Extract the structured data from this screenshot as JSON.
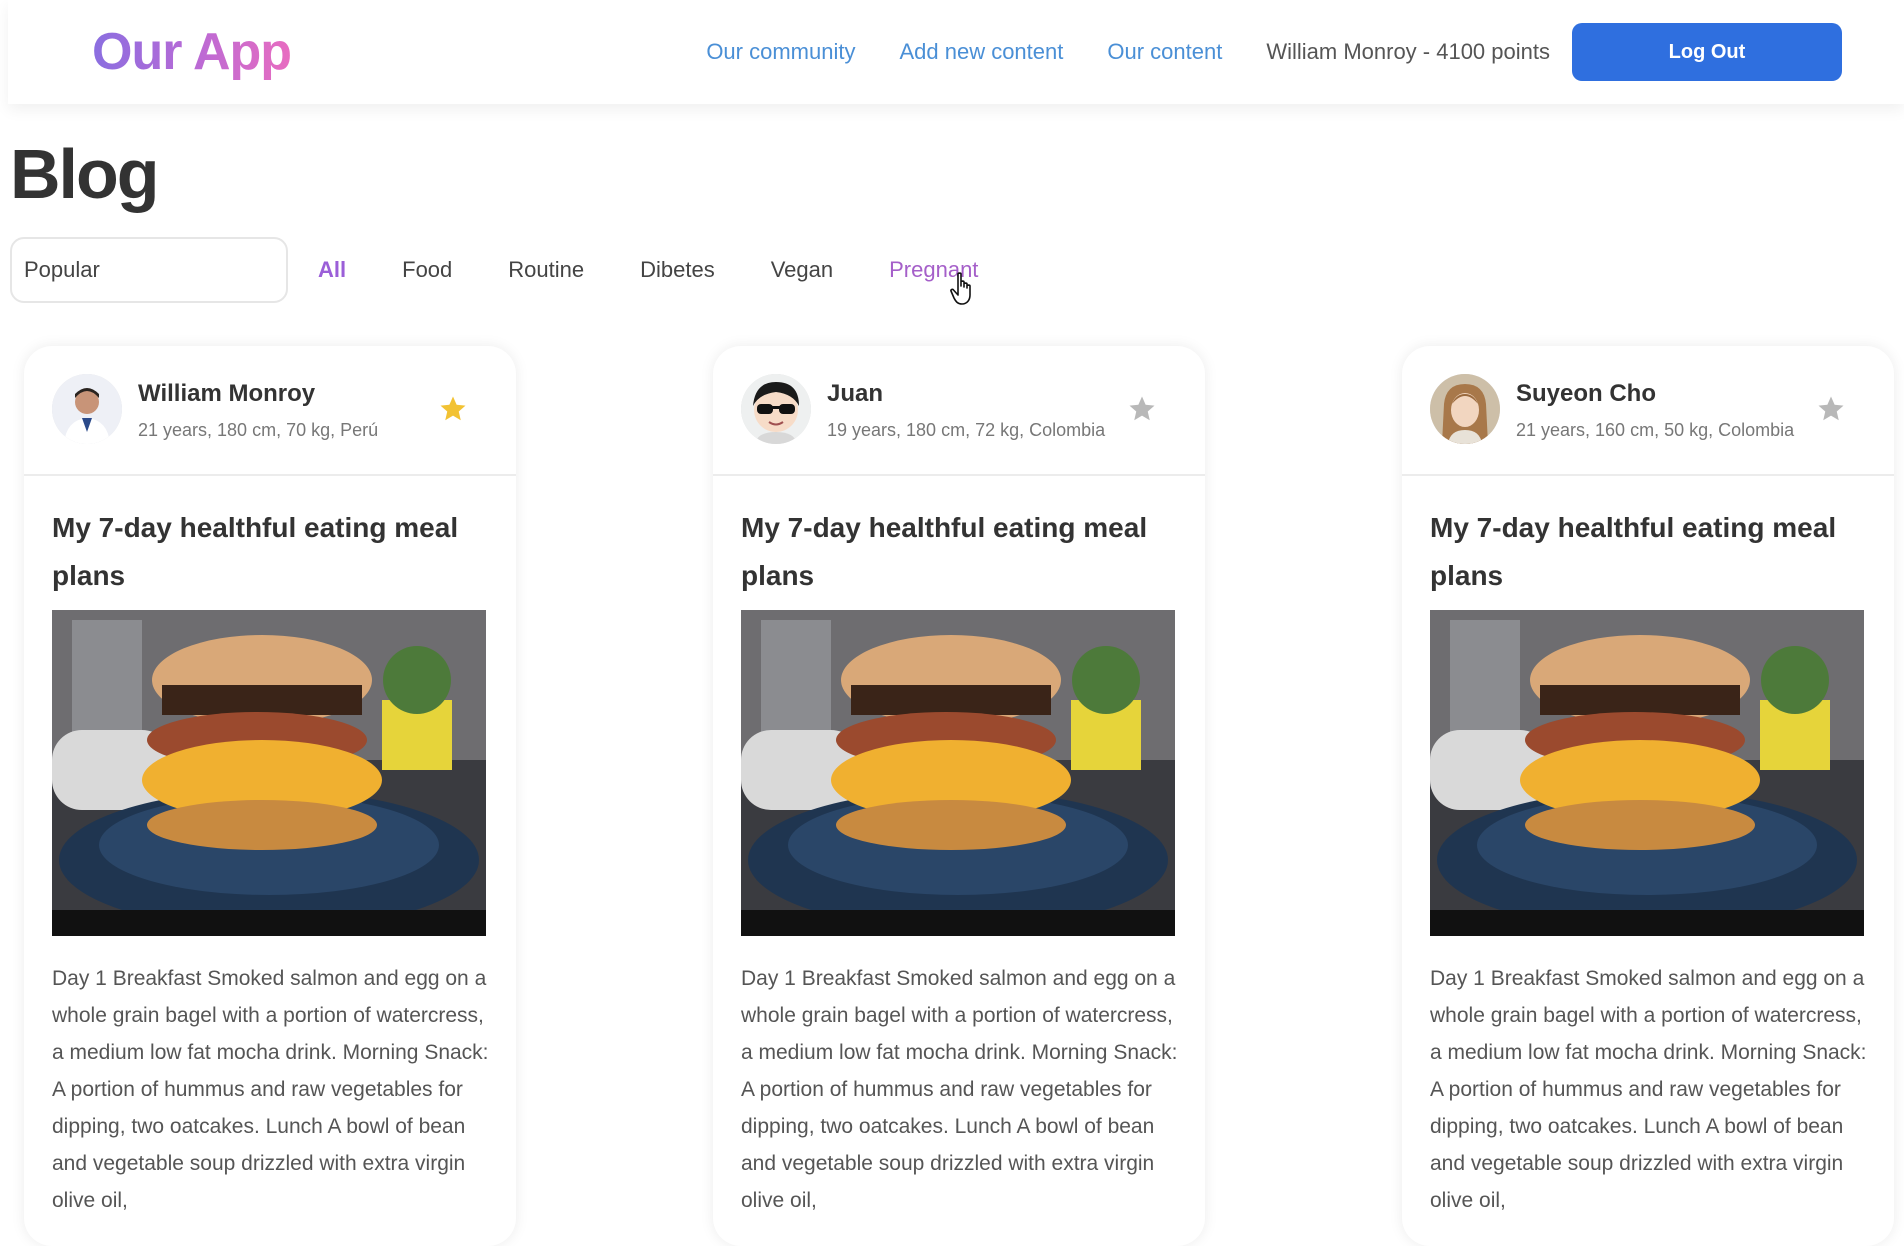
{
  "header": {
    "logo": "Our App",
    "nav": {
      "community": "Our community",
      "add_content": "Add new content",
      "our_content": "Our content"
    },
    "user_points": "William Monroy - 4100 points",
    "logout_label": "Log Out"
  },
  "page_title": "Blog",
  "filters": {
    "sort_value": "Popular",
    "tabs": [
      "All",
      "Food",
      "Routine",
      "Dibetes",
      "Vegan",
      "Pregnant"
    ],
    "active_tab": "All"
  },
  "colors": {
    "accent_blue": "#2f6fdf",
    "link_blue": "#4a8fd6",
    "active_purple": "#9b5fd8",
    "star_gold": "#f2c233",
    "star_gray": "#b8b8b8"
  },
  "posts": [
    {
      "author": "William Monroy",
      "meta": "21 years, 180 cm, 70 kg, Perú",
      "starred": true,
      "title": "My 7-day healthful eating meal plans",
      "image_icon": "burger-photo",
      "body": "Day 1 Breakfast Smoked salmon and egg on a whole grain bagel with a portion of watercress, a medium low fat mocha drink. Morning Snack: A portion of hummus and raw vegetables for dipping, two oatcakes. Lunch A bowl of bean and vegetable soup drizzled with extra virgin olive oil,"
    },
    {
      "author": "Juan",
      "meta": "19 years, 180 cm, 72 kg, Colombia",
      "starred": false,
      "title": "My 7-day healthful eating meal plans",
      "image_icon": "burger-photo",
      "body": "Day 1 Breakfast Smoked salmon and egg on a whole grain bagel with a portion of watercress, a medium low fat mocha drink. Morning Snack: A portion of hummus and raw vegetables for dipping, two oatcakes. Lunch A bowl of bean and vegetable soup drizzled with extra virgin olive oil,"
    },
    {
      "author": "Suyeon Cho",
      "meta": "21 years, 160 cm, 50 kg, Colombia",
      "starred": false,
      "title": "My 7-day healthful eating meal plans",
      "image_icon": "burger-photo",
      "body": "Day 1 Breakfast Smoked salmon and egg on a whole grain bagel with a portion of watercress, a medium low fat mocha drink. Morning Snack: A portion of hummus and raw vegetables for dipping, two oatcakes. Lunch A bowl of bean and vegetable soup drizzled with extra virgin olive oil,"
    }
  ]
}
